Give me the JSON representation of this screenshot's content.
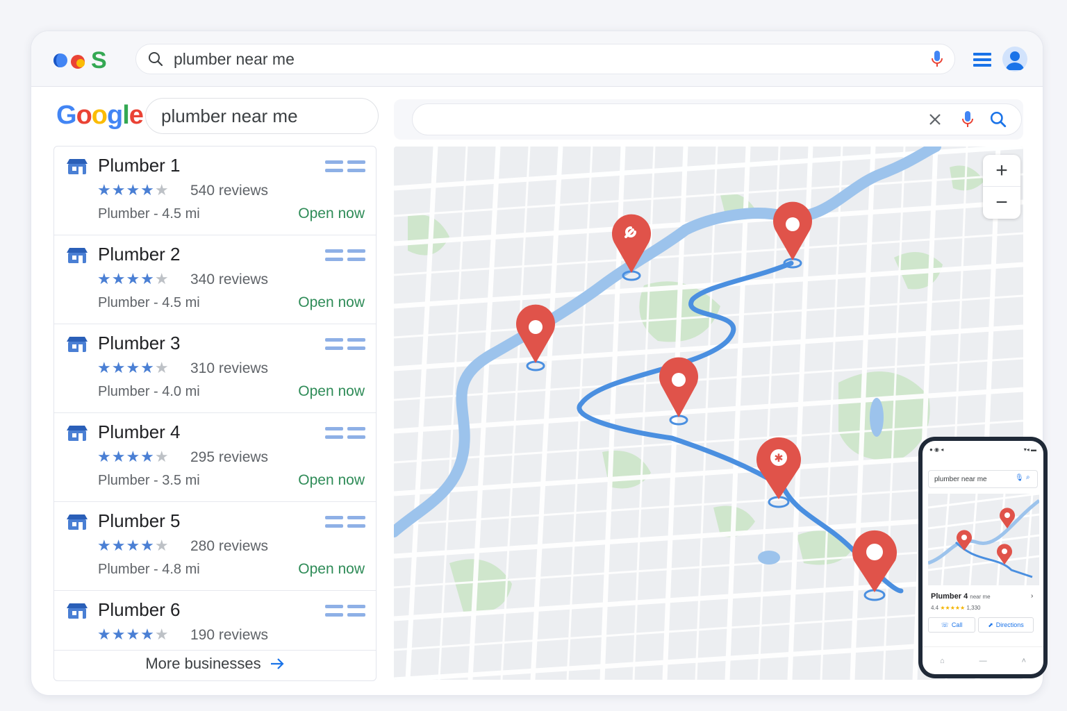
{
  "app": {
    "top_search_query": "plumber near me"
  },
  "left": {
    "search_query": "plumber near me",
    "more_label": "More businesses"
  },
  "results": [
    {
      "name": "Plumber 1",
      "rating": 4,
      "reviews": "540 reviews",
      "meta": "Plumber - 4.5 mi",
      "status": "Open now"
    },
    {
      "name": "Plumber 2",
      "rating": 4,
      "reviews": "340 reviews",
      "meta": "Plumber - 4.5 mi",
      "status": "Open now"
    },
    {
      "name": "Plumber 3",
      "rating": 4,
      "reviews": "310 reviews",
      "meta": "Plumber - 4.0 mi",
      "status": "Open now"
    },
    {
      "name": "Plumber 4",
      "rating": 4,
      "reviews": "295 reviews",
      "meta": "Plumber - 3.5 mi",
      "status": "Open now"
    },
    {
      "name": "Plumber 5",
      "rating": 4,
      "reviews": "280 reviews",
      "meta": "Plumber - 4.8 mi",
      "status": "Open now"
    },
    {
      "name": "Plumber 6",
      "rating": 4,
      "reviews": "190 reviews",
      "meta": "",
      "status": ""
    }
  ],
  "map": {
    "zoom_in": "+",
    "zoom_out": "−"
  },
  "phone": {
    "search_query": "plumber near me",
    "result_name": "Plumber 4",
    "result_suffix": "near me",
    "rating_text": "4.4",
    "reviews_text": "1,330",
    "call_label": "Call",
    "directions_label": "Directions"
  },
  "colors": {
    "accent": "#4285f4",
    "pin": "#e0534a",
    "route": "#4a8fe0",
    "open": "#2e8b57",
    "star": "#4a7fd4"
  }
}
